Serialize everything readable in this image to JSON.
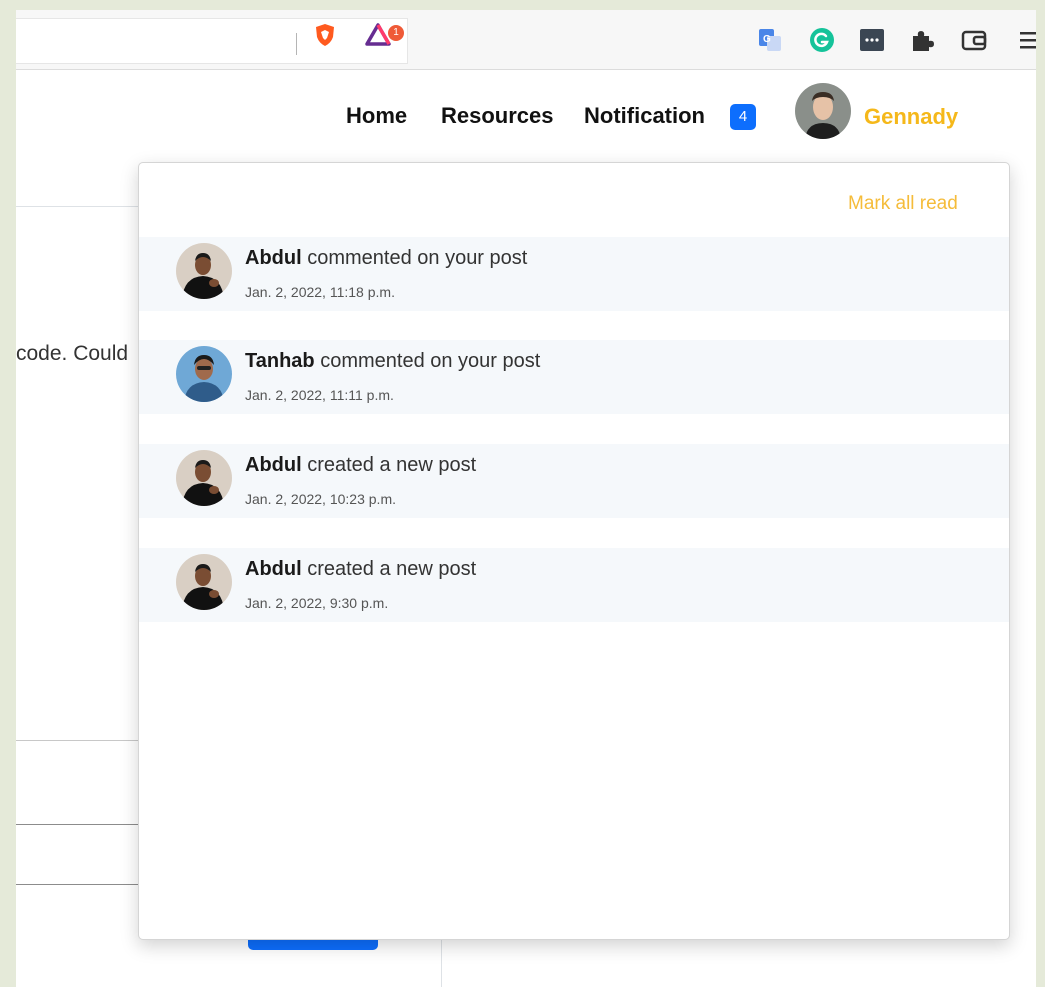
{
  "browser": {
    "rewards_badge": "1",
    "extensions": [
      "translate-icon",
      "grammarly-icon",
      "password-manager-icon",
      "extensions-puzzle-icon",
      "wallet-icon",
      "menu-icon"
    ]
  },
  "page": {
    "partial_text": "code. Could"
  },
  "navbar": {
    "home": "Home",
    "resources": "Resources",
    "notification": "Notification",
    "notification_count": "4",
    "username": "Gennady"
  },
  "notifications": {
    "mark_all_read": "Mark all read",
    "items": [
      {
        "user": "Abdul",
        "action": " commented on your post",
        "time": "Jan. 2, 2022, 11:18 p.m."
      },
      {
        "user": "Tanhab",
        "action": " commented on your post",
        "time": "Jan. 2, 2022, 11:11 p.m."
      },
      {
        "user": "Abdul",
        "action": " created a new post",
        "time": "Jan. 2, 2022, 10:23 p.m."
      },
      {
        "user": "Abdul",
        "action": " created a new post",
        "time": "Jan. 2, 2022, 9:30 p.m."
      }
    ]
  },
  "colors": {
    "accent": "#f5b81a",
    "badge": "#0d6efd",
    "notification_bg": "#f5f8fb"
  }
}
